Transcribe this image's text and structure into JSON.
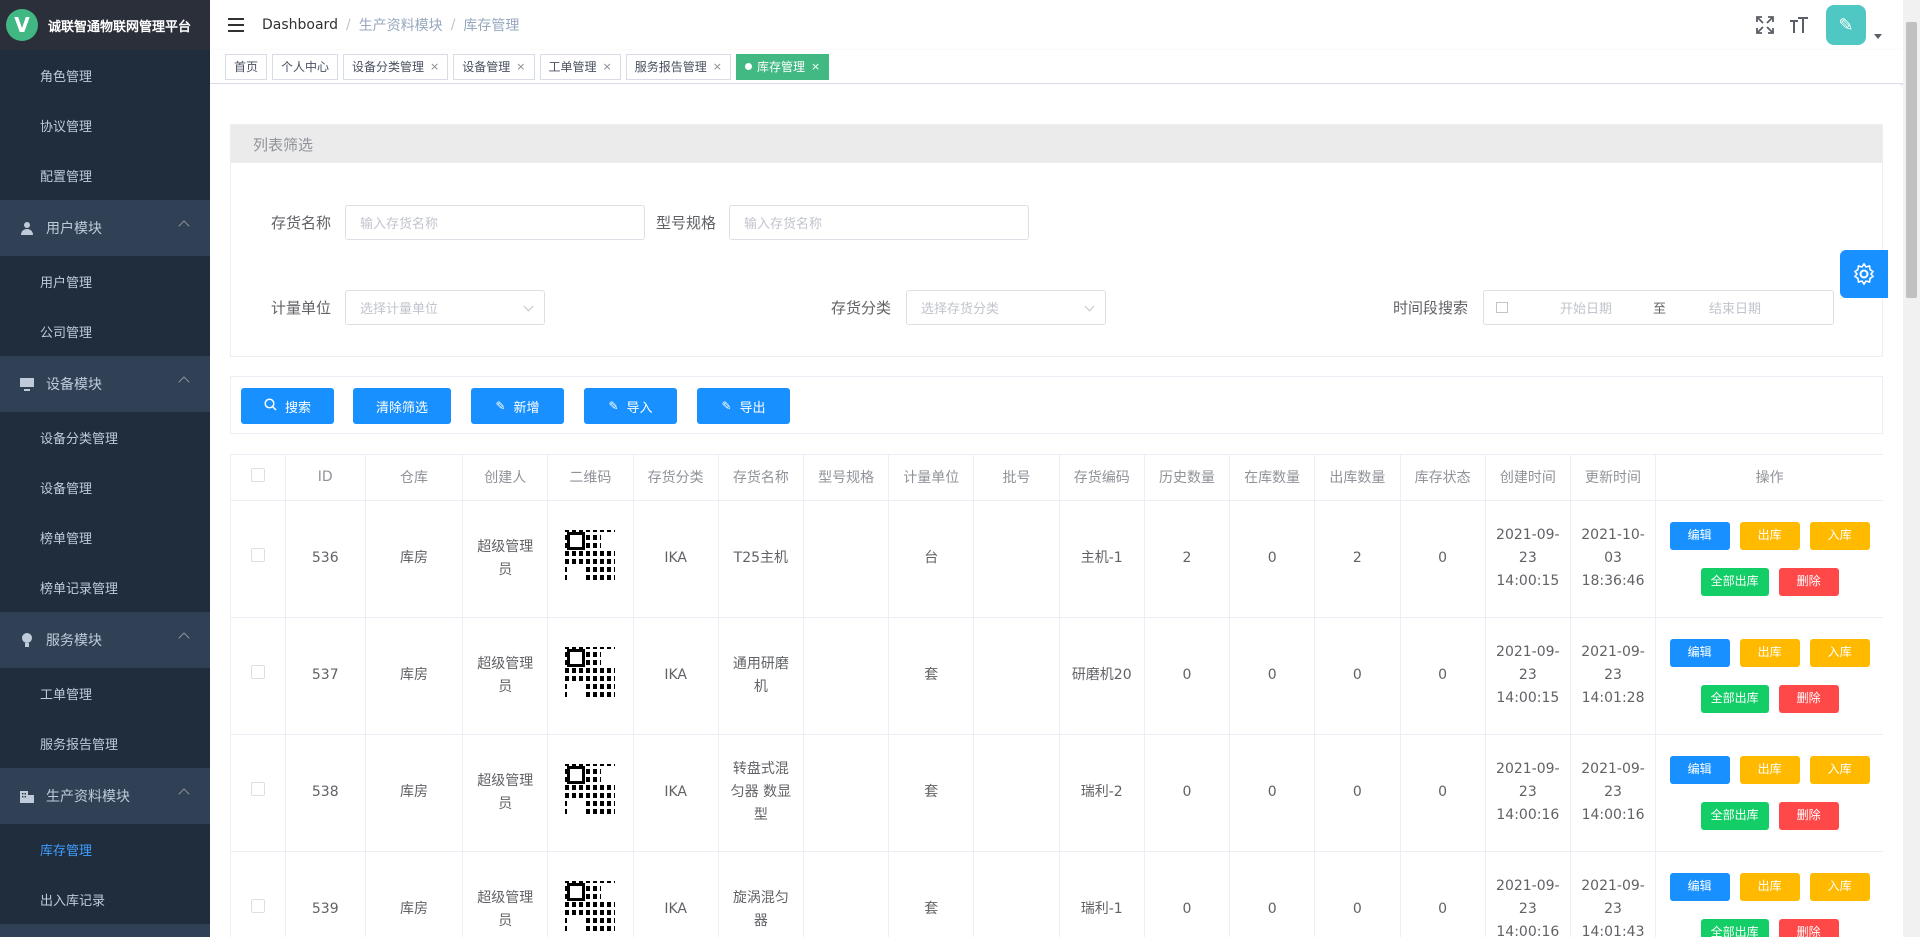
{
  "app": {
    "title": "诚联智通物联网管理平台",
    "logo_letter": "V"
  },
  "sidebar": {
    "items": [
      {
        "type": "sub",
        "label": "角色管理"
      },
      {
        "type": "sub",
        "label": "协议管理"
      },
      {
        "type": "sub",
        "label": "配置管理"
      },
      {
        "type": "group",
        "label": "用户模块",
        "icon": "user-icon"
      },
      {
        "type": "sub",
        "label": "用户管理"
      },
      {
        "type": "sub",
        "label": "公司管理"
      },
      {
        "type": "group",
        "label": "设备模块",
        "icon": "monitor-icon"
      },
      {
        "type": "sub",
        "label": "设备分类管理"
      },
      {
        "type": "sub",
        "label": "设备管理"
      },
      {
        "type": "sub",
        "label": "榜单管理"
      },
      {
        "type": "sub",
        "label": "榜单记录管理"
      },
      {
        "type": "group",
        "label": "服务模块",
        "icon": "bulb-icon"
      },
      {
        "type": "sub",
        "label": "工单管理"
      },
      {
        "type": "sub",
        "label": "服务报告管理"
      },
      {
        "type": "group",
        "label": "生产资料模块",
        "icon": "office-icon"
      },
      {
        "type": "sub",
        "label": "库存管理",
        "active": true
      },
      {
        "type": "sub",
        "label": "出入库记录"
      }
    ]
  },
  "breadcrumb": [
    "Dashboard",
    "生产资料模块",
    "库存管理"
  ],
  "tags": [
    {
      "label": "首页",
      "closable": false
    },
    {
      "label": "个人中心",
      "closable": false
    },
    {
      "label": "设备分类管理",
      "closable": true
    },
    {
      "label": "设备管理",
      "closable": true
    },
    {
      "label": "工单管理",
      "closable": true
    },
    {
      "label": "服务报告管理",
      "closable": true
    },
    {
      "label": "库存管理",
      "closable": true,
      "active": true
    }
  ],
  "filter": {
    "title": "列表筛选",
    "name_label": "存货名称",
    "name_placeholder": "输入存货名称",
    "model_label": "型号规格",
    "model_placeholder": "输入存货名称",
    "unit_label": "计量单位",
    "unit_placeholder": "选择计量单位",
    "category_label": "存货分类",
    "category_placeholder": "选择存货分类",
    "time_label": "时间段搜索",
    "start_placeholder": "开始日期",
    "range_sep": "至",
    "end_placeholder": "结束日期"
  },
  "buttons": {
    "search": "搜索",
    "clear": "清除筛选",
    "add": "新增",
    "import": "导入",
    "export": "导出"
  },
  "table": {
    "headers": [
      "ID",
      "仓库",
      "创建人",
      "二维码",
      "存货分类",
      "存货名称",
      "型号规格",
      "计量单位",
      "批号",
      "存货编码",
      "历史数量",
      "在库数量",
      "出库数量",
      "库存状态",
      "创建时间",
      "更新时间",
      "操作"
    ],
    "rows": [
      {
        "id": "536",
        "warehouse": "库房",
        "creator": "超级管理员",
        "category": "IKA",
        "name": "T25主机",
        "model": "",
        "unit": "台",
        "batch": "",
        "code": "主机-1",
        "history": "2",
        "in_stock": "0",
        "out_stock": "2",
        "status": "0",
        "created": "2021-09-23 14:00:15",
        "updated": "2021-10-03 18:36:46"
      },
      {
        "id": "537",
        "warehouse": "库房",
        "creator": "超级管理员",
        "category": "IKA",
        "name": "通用研磨机",
        "model": "",
        "unit": "套",
        "batch": "",
        "code": "研磨机20",
        "history": "0",
        "in_stock": "0",
        "out_stock": "0",
        "status": "0",
        "created": "2021-09-23 14:00:15",
        "updated": "2021-09-23 14:01:28"
      },
      {
        "id": "538",
        "warehouse": "库房",
        "creator": "超级管理员",
        "category": "IKA",
        "name": "转盘式混匀器 数显型",
        "model": "",
        "unit": "套",
        "batch": "",
        "code": "瑞利-2",
        "history": "0",
        "in_stock": "0",
        "out_stock": "0",
        "status": "0",
        "created": "2021-09-23 14:00:16",
        "updated": "2021-09-23 14:00:16"
      },
      {
        "id": "539",
        "warehouse": "库房",
        "creator": "超级管理员",
        "category": "IKA",
        "name": "旋涡混匀器",
        "model": "",
        "unit": "套",
        "batch": "",
        "code": "瑞利-1",
        "history": "0",
        "in_stock": "0",
        "out_stock": "0",
        "status": "0",
        "created": "2021-09-23 14:00:16",
        "updated": "2021-09-23 14:01:43"
      }
    ],
    "ops": {
      "edit": "编辑",
      "out": "出库",
      "in": "入库",
      "all_out": "全部出库",
      "delete": "删除"
    }
  },
  "colors": {
    "primary": "#1890ff",
    "warning": "#ffba00",
    "success": "#13ce66",
    "danger": "#ff4949",
    "sidebar": "#304156",
    "tag_active": "#42b983"
  }
}
